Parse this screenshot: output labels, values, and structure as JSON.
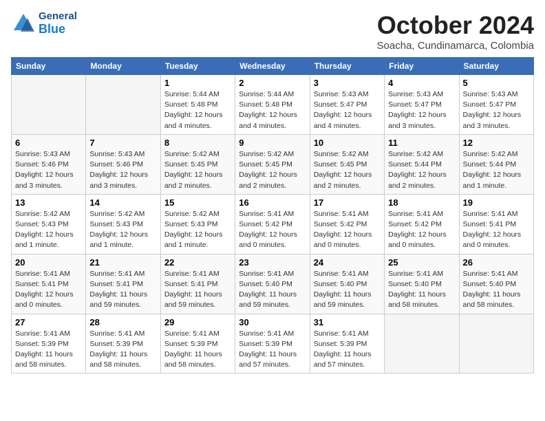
{
  "logo": {
    "general": "General",
    "blue": "Blue"
  },
  "title": "October 2024",
  "subtitle": "Soacha, Cundinamarca, Colombia",
  "weekdays": [
    "Sunday",
    "Monday",
    "Tuesday",
    "Wednesday",
    "Thursday",
    "Friday",
    "Saturday"
  ],
  "weeks": [
    [
      {
        "day": "",
        "info": ""
      },
      {
        "day": "",
        "info": ""
      },
      {
        "day": "1",
        "info": "Sunrise: 5:44 AM\nSunset: 5:48 PM\nDaylight: 12 hours\nand 4 minutes."
      },
      {
        "day": "2",
        "info": "Sunrise: 5:44 AM\nSunset: 5:48 PM\nDaylight: 12 hours\nand 4 minutes."
      },
      {
        "day": "3",
        "info": "Sunrise: 5:43 AM\nSunset: 5:47 PM\nDaylight: 12 hours\nand 4 minutes."
      },
      {
        "day": "4",
        "info": "Sunrise: 5:43 AM\nSunset: 5:47 PM\nDaylight: 12 hours\nand 3 minutes."
      },
      {
        "day": "5",
        "info": "Sunrise: 5:43 AM\nSunset: 5:47 PM\nDaylight: 12 hours\nand 3 minutes."
      }
    ],
    [
      {
        "day": "6",
        "info": "Sunrise: 5:43 AM\nSunset: 5:46 PM\nDaylight: 12 hours\nand 3 minutes."
      },
      {
        "day": "7",
        "info": "Sunrise: 5:43 AM\nSunset: 5:46 PM\nDaylight: 12 hours\nand 3 minutes."
      },
      {
        "day": "8",
        "info": "Sunrise: 5:42 AM\nSunset: 5:45 PM\nDaylight: 12 hours\nand 2 minutes."
      },
      {
        "day": "9",
        "info": "Sunrise: 5:42 AM\nSunset: 5:45 PM\nDaylight: 12 hours\nand 2 minutes."
      },
      {
        "day": "10",
        "info": "Sunrise: 5:42 AM\nSunset: 5:45 PM\nDaylight: 12 hours\nand 2 minutes."
      },
      {
        "day": "11",
        "info": "Sunrise: 5:42 AM\nSunset: 5:44 PM\nDaylight: 12 hours\nand 2 minutes."
      },
      {
        "day": "12",
        "info": "Sunrise: 5:42 AM\nSunset: 5:44 PM\nDaylight: 12 hours\nand 1 minute."
      }
    ],
    [
      {
        "day": "13",
        "info": "Sunrise: 5:42 AM\nSunset: 5:43 PM\nDaylight: 12 hours\nand 1 minute."
      },
      {
        "day": "14",
        "info": "Sunrise: 5:42 AM\nSunset: 5:43 PM\nDaylight: 12 hours\nand 1 minute."
      },
      {
        "day": "15",
        "info": "Sunrise: 5:42 AM\nSunset: 5:43 PM\nDaylight: 12 hours\nand 1 minute."
      },
      {
        "day": "16",
        "info": "Sunrise: 5:41 AM\nSunset: 5:42 PM\nDaylight: 12 hours\nand 0 minutes."
      },
      {
        "day": "17",
        "info": "Sunrise: 5:41 AM\nSunset: 5:42 PM\nDaylight: 12 hours\nand 0 minutes."
      },
      {
        "day": "18",
        "info": "Sunrise: 5:41 AM\nSunset: 5:42 PM\nDaylight: 12 hours\nand 0 minutes."
      },
      {
        "day": "19",
        "info": "Sunrise: 5:41 AM\nSunset: 5:41 PM\nDaylight: 12 hours\nand 0 minutes."
      }
    ],
    [
      {
        "day": "20",
        "info": "Sunrise: 5:41 AM\nSunset: 5:41 PM\nDaylight: 12 hours\nand 0 minutes."
      },
      {
        "day": "21",
        "info": "Sunrise: 5:41 AM\nSunset: 5:41 PM\nDaylight: 11 hours\nand 59 minutes."
      },
      {
        "day": "22",
        "info": "Sunrise: 5:41 AM\nSunset: 5:41 PM\nDaylight: 11 hours\nand 59 minutes."
      },
      {
        "day": "23",
        "info": "Sunrise: 5:41 AM\nSunset: 5:40 PM\nDaylight: 11 hours\nand 59 minutes."
      },
      {
        "day": "24",
        "info": "Sunrise: 5:41 AM\nSunset: 5:40 PM\nDaylight: 11 hours\nand 59 minutes."
      },
      {
        "day": "25",
        "info": "Sunrise: 5:41 AM\nSunset: 5:40 PM\nDaylight: 11 hours\nand 58 minutes."
      },
      {
        "day": "26",
        "info": "Sunrise: 5:41 AM\nSunset: 5:40 PM\nDaylight: 11 hours\nand 58 minutes."
      }
    ],
    [
      {
        "day": "27",
        "info": "Sunrise: 5:41 AM\nSunset: 5:39 PM\nDaylight: 11 hours\nand 58 minutes."
      },
      {
        "day": "28",
        "info": "Sunrise: 5:41 AM\nSunset: 5:39 PM\nDaylight: 11 hours\nand 58 minutes."
      },
      {
        "day": "29",
        "info": "Sunrise: 5:41 AM\nSunset: 5:39 PM\nDaylight: 11 hours\nand 58 minutes."
      },
      {
        "day": "30",
        "info": "Sunrise: 5:41 AM\nSunset: 5:39 PM\nDaylight: 11 hours\nand 57 minutes."
      },
      {
        "day": "31",
        "info": "Sunrise: 5:41 AM\nSunset: 5:39 PM\nDaylight: 11 hours\nand 57 minutes."
      },
      {
        "day": "",
        "info": ""
      },
      {
        "day": "",
        "info": ""
      }
    ]
  ]
}
